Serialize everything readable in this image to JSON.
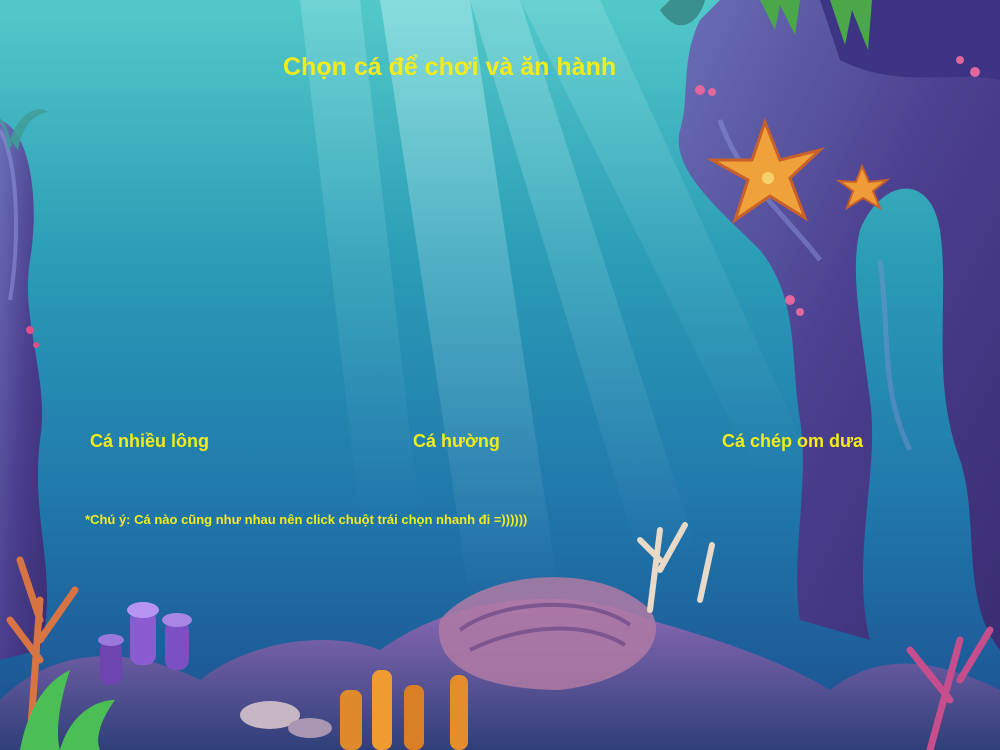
{
  "title": "Chọn cá để chơi và ăn hành",
  "fish_options": [
    {
      "label": "Cá nhiều lông"
    },
    {
      "label": "Cá hường"
    },
    {
      "label": "Cá chép om dưa"
    }
  ],
  "note": "*Chú ý: Cá nào cũng như nhau nên click chuột trái chọn nhanh đi =))))))",
  "colors": {
    "text": "#f3ec1a",
    "water_top": "#4cc6c8",
    "water_bottom": "#1a4f93",
    "rock": "#4a3f8a",
    "starfish": "#f0a23a"
  },
  "background": {
    "scene": "underwater-coral-reef",
    "icons": [
      "starfish-icon",
      "coral-icon",
      "rock-arch-icon",
      "seaweed-icon"
    ]
  }
}
